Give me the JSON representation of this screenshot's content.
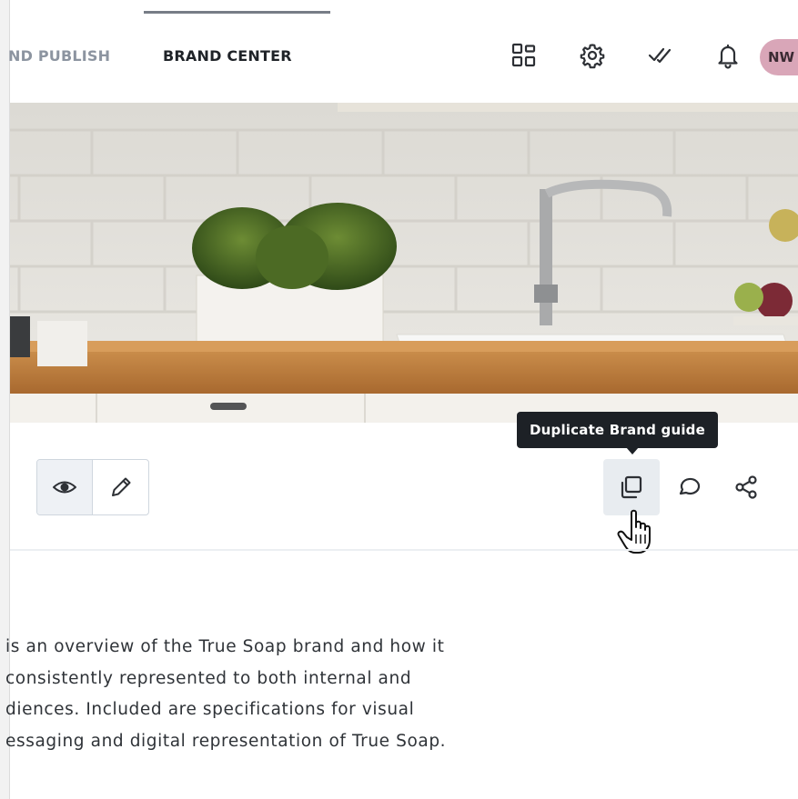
{
  "nav": {
    "tabs": [
      {
        "label": "ND PUBLISH",
        "active": false
      },
      {
        "label": "BRAND CENTER",
        "active": true
      }
    ],
    "icons": [
      "apps-grid-icon",
      "settings-gear-icon",
      "tasks-check-icon",
      "notifications-bell-icon"
    ],
    "avatar_initials": "NW",
    "avatar_color": "#d9a6b8"
  },
  "hero": {
    "image": "kitchen-sink-photo"
  },
  "toolbar": {
    "view_toggle": [
      {
        "icon": "eye-icon",
        "selected": true
      },
      {
        "icon": "pencil-icon",
        "selected": false
      }
    ],
    "actions": [
      "duplicate-icon",
      "comment-icon",
      "share-icon"
    ],
    "tooltip": "Duplicate Brand guide"
  },
  "description": {
    "lines": [
      "is an overview of the True Soap brand and how it",
      "consistently represented to both internal and",
      "diences. Included are specifications for visual",
      "essaging and digital representation of True Soap."
    ]
  },
  "colors": {
    "nav_active": "#1f2328",
    "nav_inactive": "#8c94a0",
    "tooltip_bg": "#1d2126",
    "hover_bg": "#e8ecf0"
  }
}
